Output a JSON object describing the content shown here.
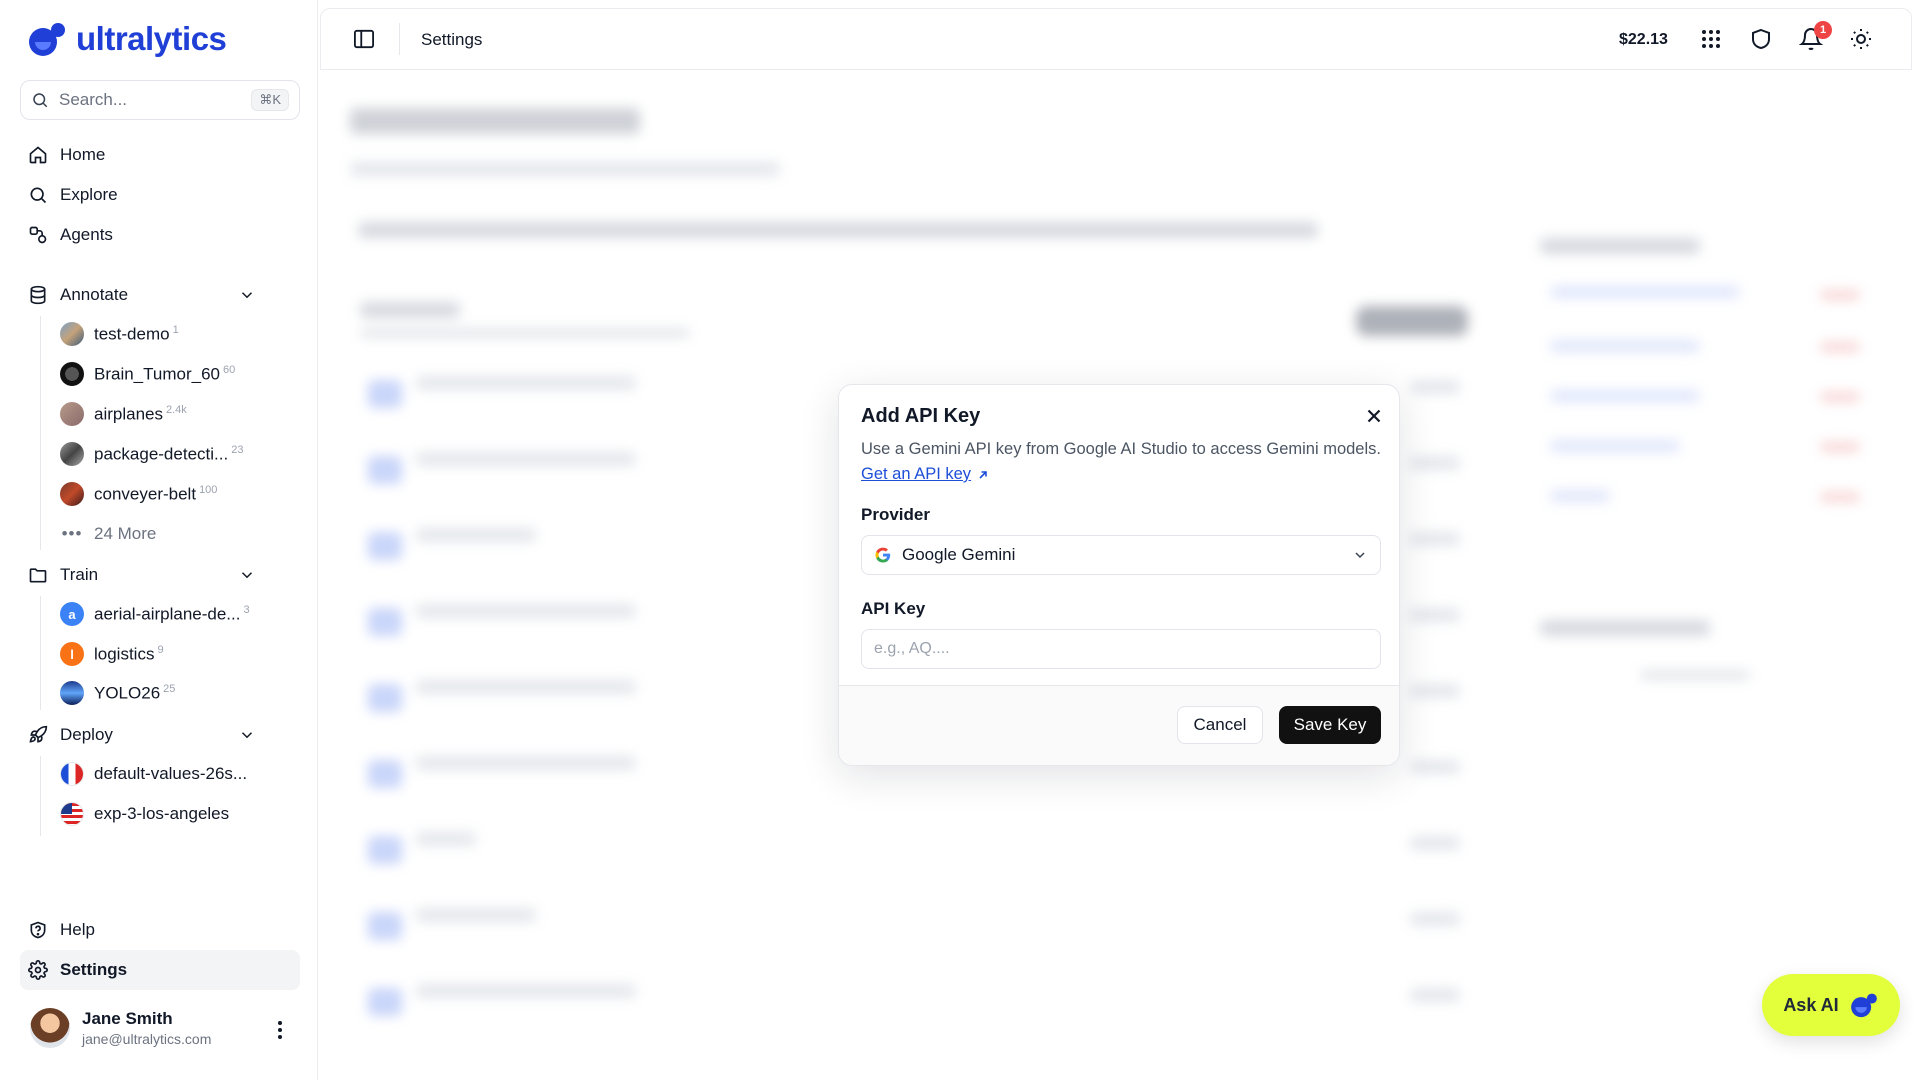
{
  "app": {
    "logo_text": "ultralytics",
    "brand_color": "#1f3fd6",
    "accent_color": "#e3ff3c"
  },
  "sidebar": {
    "search": {
      "placeholder": "Search...",
      "shortcut": "⌘K"
    },
    "primary": [
      {
        "label": "Home",
        "icon": "home-icon"
      },
      {
        "label": "Explore",
        "icon": "search-icon"
      },
      {
        "label": "Agents",
        "icon": "agents-icon"
      }
    ],
    "annotate": {
      "label": "Annotate",
      "items": [
        {
          "label": "test-demo",
          "count": "1"
        },
        {
          "label": "Brain_Tumor_60",
          "count": "60"
        },
        {
          "label": "airplanes",
          "count": "2.4k"
        },
        {
          "label": "package-detecti...",
          "count": "23"
        },
        {
          "label": "conveyer-belt",
          "count": "100"
        }
      ],
      "more_label": "24 More"
    },
    "train": {
      "label": "Train",
      "items": [
        {
          "label": "aerial-airplane-de...",
          "count": "3",
          "avatar_letter": "a",
          "avatar_color": "#3b82f6"
        },
        {
          "label": "logistics",
          "count": "9",
          "avatar_letter": "l",
          "avatar_color": "#f97316"
        },
        {
          "label": "YOLO26",
          "count": "25"
        }
      ]
    },
    "deploy": {
      "label": "Deploy",
      "items": [
        {
          "label": "default-values-26s..."
        },
        {
          "label": "exp-3-los-angeles"
        }
      ]
    },
    "bottom": [
      {
        "label": "Help",
        "icon": "help-icon"
      },
      {
        "label": "Settings",
        "icon": "gear-icon",
        "active": true
      }
    ],
    "user": {
      "name": "Jane Smith",
      "email": "jane@ultralytics.com"
    }
  },
  "header": {
    "title": "Settings",
    "credits": "$22.13",
    "notification_count": "1"
  },
  "modal": {
    "title": "Add API Key",
    "description": "Use a Gemini API key from Google AI Studio to access Gemini models.",
    "link_text": "Get an API key",
    "provider_label": "Provider",
    "provider_value": "Google Gemini",
    "api_key_label": "API Key",
    "api_key_placeholder": "e.g., AQ....",
    "api_key_value": "",
    "cancel_label": "Cancel",
    "save_label": "Save Key"
  },
  "ask_ai": {
    "label": "Ask AI"
  }
}
